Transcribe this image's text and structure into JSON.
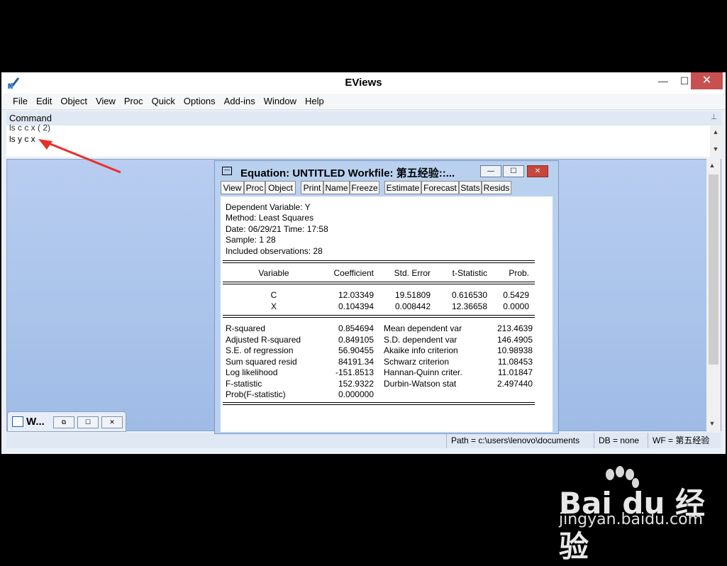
{
  "app": {
    "title": "EViews",
    "window_buttons": {
      "minimize": "—",
      "maximize": "☐",
      "close": "✕"
    }
  },
  "menu": [
    "File",
    "Edit",
    "Object",
    "View",
    "Proc",
    "Quick",
    "Options",
    "Add-ins",
    "Window",
    "Help"
  ],
  "command": {
    "label": "Command",
    "previous_line": "ls c c x ( 2)",
    "current_line": "ls y c x"
  },
  "minimized_window": {
    "title": "W..."
  },
  "equation": {
    "title": "Equation: UNTITLED   Workfile: 第五经验::...",
    "toolbar": [
      "View",
      "Proc",
      "Object",
      "Print",
      "Name",
      "Freeze",
      "Estimate",
      "Forecast",
      "Stats",
      "Resids"
    ],
    "header": [
      "Dependent Variable: Y",
      "Method: Least Squares",
      "Date: 06/29/21   Time: 17:58",
      "Sample: 1 28",
      "Included observations: 28"
    ],
    "columns": [
      "Variable",
      "Coefficient",
      "Std. Error",
      "t-Statistic",
      "Prob."
    ],
    "rows": [
      [
        "C",
        "12.03349",
        "19.51809",
        "0.616530",
        "0.5429"
      ],
      [
        "X",
        "0.104394",
        "0.008442",
        "12.36658",
        "0.0000"
      ]
    ],
    "stats": [
      [
        "R-squared",
        "0.854694",
        "Mean dependent var",
        "213.4639"
      ],
      [
        "Adjusted R-squared",
        "0.849105",
        "S.D. dependent var",
        "146.4905"
      ],
      [
        "S.E. of regression",
        "56.90455",
        "Akaike info criterion",
        "10.98938"
      ],
      [
        "Sum squared resid",
        "84191.34",
        "Schwarz criterion",
        "11.08453"
      ],
      [
        "Log likelihood",
        "-151.8513",
        "Hannan-Quinn criter.",
        "11.01847"
      ],
      [
        "F-statistic",
        "152.9322",
        "Durbin-Watson stat",
        "2.497440"
      ],
      [
        "Prob(F-statistic)",
        "0.000000",
        "",
        ""
      ]
    ]
  },
  "status": {
    "path": "Path = c:\\users\\lenovo\\documents",
    "db": "DB = none",
    "wf": "WF = 第五经验"
  },
  "watermark": {
    "brand": "Bai du 经验",
    "url": "jingyan.baidu.com"
  },
  "colors": {
    "accent_arrow": "#e8302a",
    "close_button": "#c75050"
  }
}
